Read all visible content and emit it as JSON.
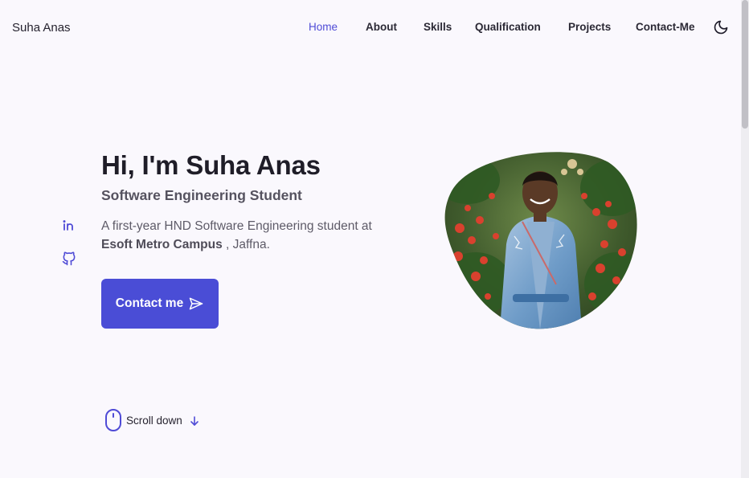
{
  "brand": {
    "name": "Suha Anas"
  },
  "nav": {
    "items": [
      {
        "label": "Home",
        "active": true
      },
      {
        "label": "About",
        "active": false
      },
      {
        "label": "Skills",
        "active": false
      },
      {
        "label": "Qualification",
        "active": false
      },
      {
        "label": "Projects",
        "active": false
      },
      {
        "label": "Contact-Me",
        "active": false
      }
    ],
    "theme_toggle_icon": "moon-icon"
  },
  "socials": [
    {
      "icon": "linkedin-icon"
    },
    {
      "icon": "github-icon"
    }
  ],
  "hero": {
    "title": "Hi, I'm Suha Anas",
    "subtitle": "Software Engineering Student",
    "description_before": "A first-year HND Software Engineering student at",
    "description_strong": "Esoft Metro Campus",
    "description_after": ", Jaffna.",
    "cta_label": "Contact me",
    "cta_icon": "send-icon",
    "photo_icon": "profile-photo-blob"
  },
  "scroll": {
    "label": "Scroll down",
    "mouse_icon": "mouse-icon",
    "arrow_icon": "arrow-down-icon"
  },
  "colors": {
    "accent": "#4a4dd6",
    "background": "#faf8fd",
    "title_text": "#1f1d28",
    "body_text": "#5e5b68"
  }
}
